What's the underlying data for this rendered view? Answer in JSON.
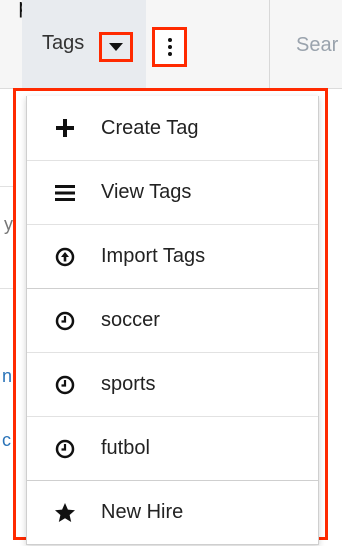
{
  "header": {
    "fragment_top": "play",
    "tags_label": "Tags",
    "search_placeholder": "Sear"
  },
  "background": {
    "left_fragment_1": "y",
    "left_fragment_2": "n",
    "left_fragment_3": "c"
  },
  "menu": {
    "items": [
      {
        "label": "Create Tag",
        "icon": "plus-icon"
      },
      {
        "label": "View Tags",
        "icon": "list-icon"
      },
      {
        "label": "Import Tags",
        "icon": "import-icon"
      },
      {
        "label": "soccer",
        "icon": "clock-icon"
      },
      {
        "label": "sports",
        "icon": "clock-icon"
      },
      {
        "label": "futbol",
        "icon": "clock-icon"
      },
      {
        "label": "New Hire",
        "icon": "star-icon"
      }
    ]
  },
  "colors": {
    "highlight": "#ff2a00",
    "link": "#2a73b8"
  }
}
